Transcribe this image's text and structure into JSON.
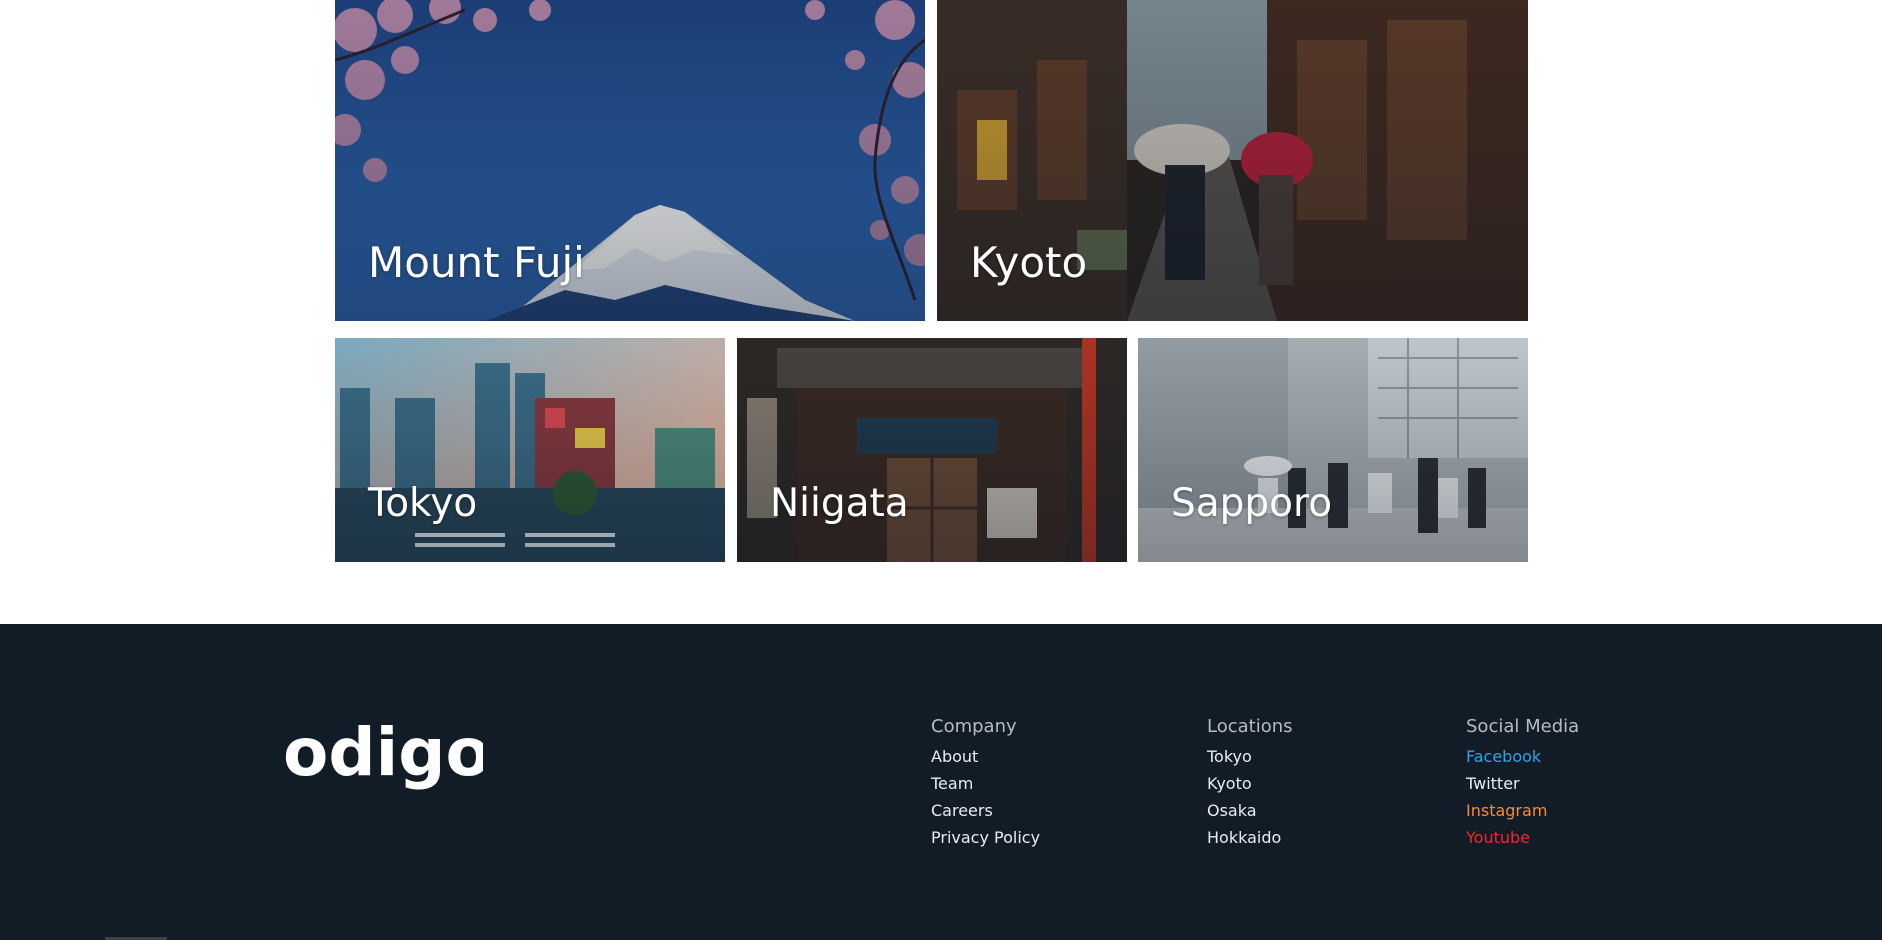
{
  "destinations": {
    "fuji": {
      "name": "Mount Fuji"
    },
    "kyoto": {
      "name": "Kyoto"
    },
    "tokyo": {
      "name": "Tokyo"
    },
    "niigata": {
      "name": "Niigata"
    },
    "sapporo": {
      "name": "Sapporo"
    }
  },
  "footer": {
    "logo": "odigo",
    "company": {
      "heading": "Company",
      "links": [
        "About",
        "Team",
        "Careers",
        "Privacy Policy"
      ]
    },
    "locations": {
      "heading": "Locations",
      "links": [
        "Tokyo",
        "Kyoto",
        "Osaka",
        "Hokkaido"
      ]
    },
    "social": {
      "heading": "Social Media",
      "links": [
        "Facebook",
        "Twitter",
        "Instagram",
        "Youtube"
      ]
    }
  },
  "colors": {
    "footer_bg": "#111c27",
    "facebook": "#2fa4e7",
    "twitter": "#e9ecef",
    "instagram": "#f58a3a",
    "youtube": "#ee2a2a"
  }
}
